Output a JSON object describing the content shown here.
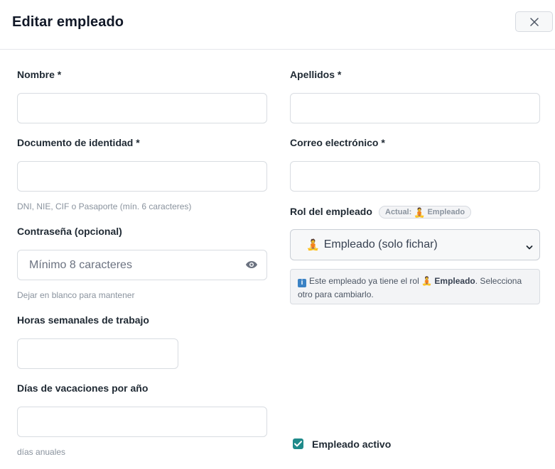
{
  "dialog": {
    "title": "Editar empleado"
  },
  "fields": {
    "nombre": {
      "label": "Nombre *",
      "value": ""
    },
    "apellidos": {
      "label": "Apellidos *",
      "value": ""
    },
    "documento": {
      "label": "Documento de identidad *",
      "value": "",
      "help": "DNI, NIE, CIF o Pasaporte (mín. 6 caracteres)"
    },
    "correo": {
      "label": "Correo electrónico *",
      "value": ""
    },
    "password": {
      "label": "Contraseña (opcional)",
      "placeholder": "Mínimo 8 caracteres",
      "help": "Dejar en blanco para mantener"
    },
    "horas": {
      "label": "Horas semanales de trabajo",
      "value": ""
    },
    "vacaciones": {
      "label": "Días de vacaciones por año",
      "value": "",
      "help": "días anuales"
    }
  },
  "role": {
    "label": "Rol del empleado",
    "badge_prefix": "Actual:",
    "badge_emoji": "🧘",
    "badge_value": "Empleado",
    "select_emoji": "🧘",
    "selected_option": "Empleado (solo fichar)",
    "info_prefix": "Este empleado ya tiene el rol",
    "info_emoji": "🧘",
    "info_role": "Empleado",
    "info_suffix": ". Selecciona otro para cambiarlo."
  },
  "active": {
    "label": "Empleado activo",
    "checked": true
  },
  "colors": {
    "accent": "#1f8a8a",
    "info_icon": "#3b82c4"
  }
}
